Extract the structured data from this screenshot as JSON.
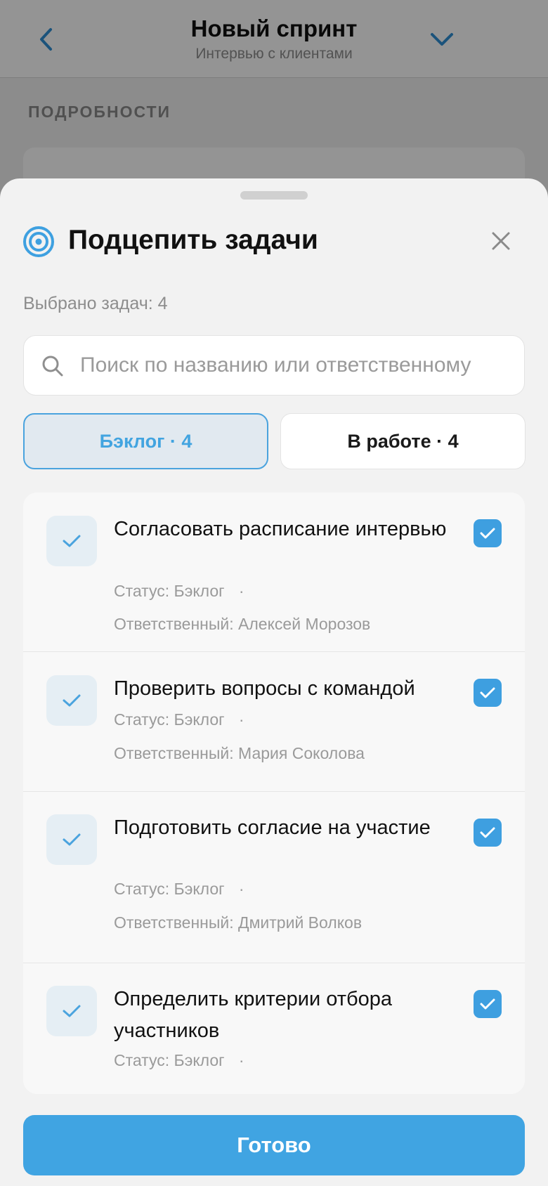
{
  "header": {
    "title": "Новый спринт",
    "subtitle": "Интервью с клиентами",
    "back_icon": "chevron-left-icon",
    "menu_icon": "chevron-down-icon",
    "accent": "#2f8fd5"
  },
  "background": {
    "section_title": "ПОДРОБНОСТИ"
  },
  "sheet": {
    "title": "Подцепить задачи",
    "title_icon": "target-icon",
    "close_icon": "close-icon",
    "selected_count": "Выбрано задач: 4",
    "search": {
      "value": "",
      "placeholder": "Поиск по названию или ответственному"
    },
    "tabs": [
      {
        "label": "Бэклог · 4",
        "active": true
      },
      {
        "label": "В работе · 4",
        "active": false
      }
    ],
    "tasks": [
      {
        "title": "Согласовать расписание интервью",
        "status": "Статус: Бэклог",
        "separator": "·",
        "assignee": "Ответственный: Алексей Морозов",
        "checked": true
      },
      {
        "title": "Проверить вопросы с командой",
        "status": "Статус: Бэклог",
        "separator": "·",
        "assignee": "Ответственный: Мария Соколова",
        "checked": true
      },
      {
        "title": "Подготовить согласие на участие",
        "status": "Статус: Бэклог",
        "separator": "·",
        "assignee": "Ответственный: Дмитрий Волков",
        "checked": true
      },
      {
        "title": "Определить критерии отбора участников",
        "status": "Статус: Бэклог",
        "separator": "·",
        "assignee": "",
        "checked": true
      }
    ],
    "done_label": "Готово"
  },
  "colors": {
    "primary": "#40a4e2",
    "tab_active_bg": "#e1e9f0",
    "muted_text": "#9a9a9a"
  }
}
